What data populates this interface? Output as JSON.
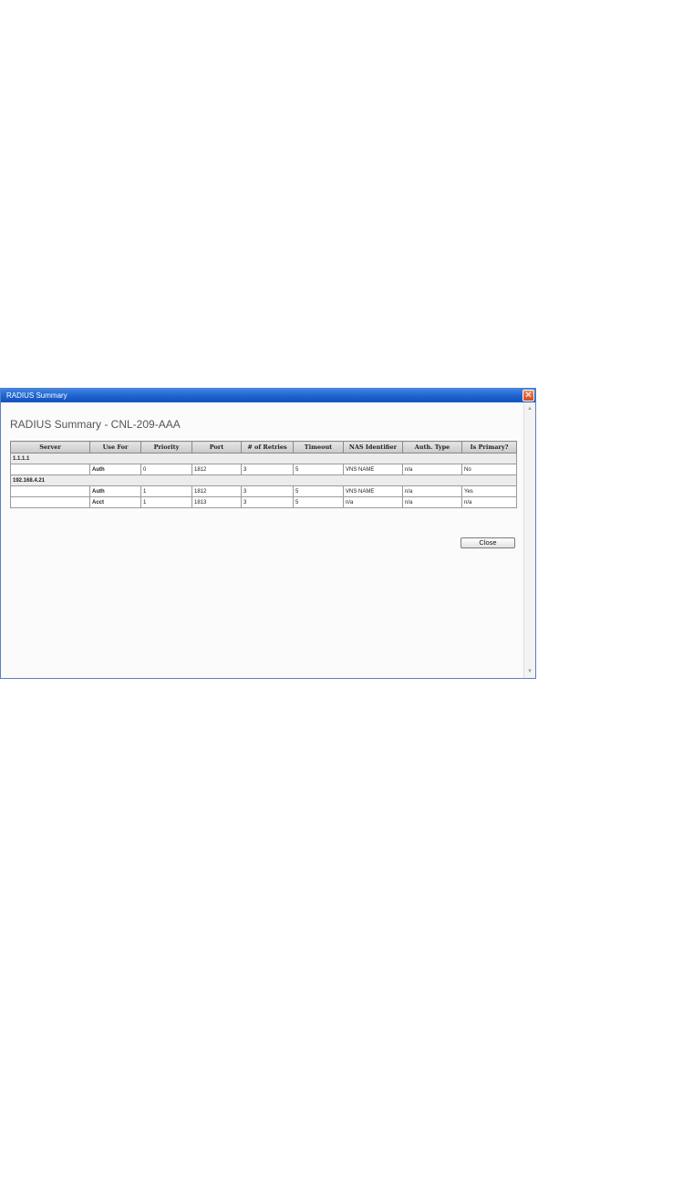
{
  "window": {
    "title": "RADIUS Summary",
    "close_glyph": "✕"
  },
  "page": {
    "heading": "RADIUS Summary - CNL-209-AAA"
  },
  "table": {
    "headers": [
      "Server",
      "Use For",
      "Priority",
      "Port",
      "# of Retries",
      "Timeout",
      "NAS Identifier",
      "Auth. Type",
      "Is Primary?"
    ],
    "groups": [
      {
        "server": "1.1.1.1",
        "rows": [
          [
            "",
            "Auth",
            "0",
            "1812",
            "3",
            "5",
            "VNS NAME",
            "n/a",
            "No"
          ]
        ]
      },
      {
        "server": "192.168.4.21",
        "rows": [
          [
            "",
            "Auth",
            "1",
            "1812",
            "3",
            "5",
            "VNS NAME",
            "n/a",
            "Yes"
          ],
          [
            "",
            "Acct",
            "1",
            "1813",
            "3",
            "5",
            "n/a",
            "n/a",
            "n/a"
          ]
        ]
      }
    ]
  },
  "buttons": {
    "close_label": "Close"
  },
  "scrollbar": {
    "up_glyph": "▲",
    "down_glyph": "▼"
  }
}
